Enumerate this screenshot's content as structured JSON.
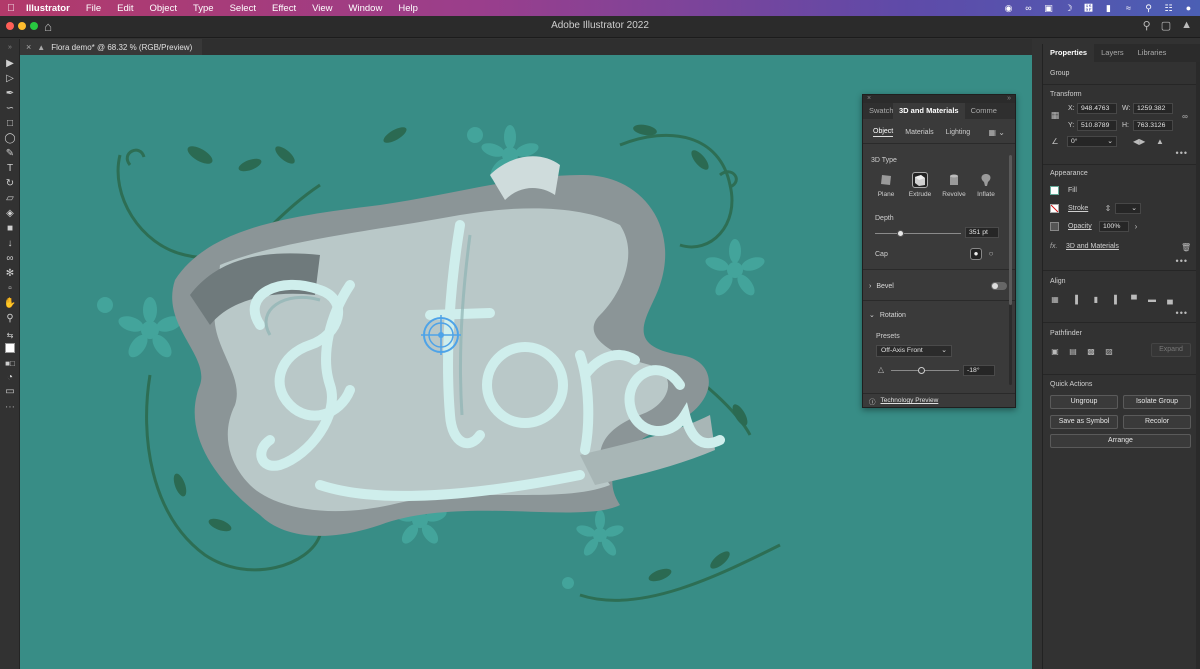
{
  "menubar": {
    "items": [
      "Illustrator",
      "File",
      "Edit",
      "Object",
      "Type",
      "Select",
      "Effect",
      "View",
      "Window",
      "Help"
    ]
  },
  "app": {
    "title": "Adobe Illustrator 2022"
  },
  "document": {
    "tab_label": "Flora demo* @ 68.32 % (RGB/Preview)"
  },
  "panel3d": {
    "tabs": [
      "Swatch",
      "3D and Materials",
      "Comme"
    ],
    "subtabs": [
      "Object",
      "Materials",
      "Lighting"
    ],
    "type_section_label": "3D Type",
    "types": [
      "Plane",
      "Extrude",
      "Revolve",
      "Inflate"
    ],
    "active_type": "Extrude",
    "depth_label": "Depth",
    "depth_value": "351 pt",
    "depth_fraction": 0.3,
    "cap_label": "Cap",
    "bevel_label": "Bevel",
    "rotation_label": "Rotation",
    "presets_label": "Presets",
    "preset_value": "Off-Axis Front",
    "rotation_value": "-18°",
    "rotation_fraction": 0.45,
    "footer_link": "Technology Preview"
  },
  "props": {
    "tabs": [
      "Properties",
      "Layers",
      "Libraries"
    ],
    "selection_type": "Group",
    "transform": {
      "label": "Transform",
      "x_label": "X:",
      "x": "948.4763",
      "y_label": "Y:",
      "y": "510.8789",
      "w_label": "W:",
      "w": "1259.382",
      "h_label": "H:",
      "h": "763.3126",
      "angle": "0°"
    },
    "appearance": {
      "label": "Appearance",
      "fill": "Fill",
      "stroke": "Stroke",
      "opacity": "Opacity",
      "opacity_value": "100%",
      "effect": "3D and Materials"
    },
    "align_label": "Align",
    "pathfinder_label": "Pathfinder",
    "expand_label": "Expand",
    "quick_actions": {
      "label": "Quick Actions",
      "buttons": [
        "Ungroup",
        "Isolate Group",
        "Save as Symbol",
        "Recolor",
        "Arrange"
      ]
    }
  }
}
